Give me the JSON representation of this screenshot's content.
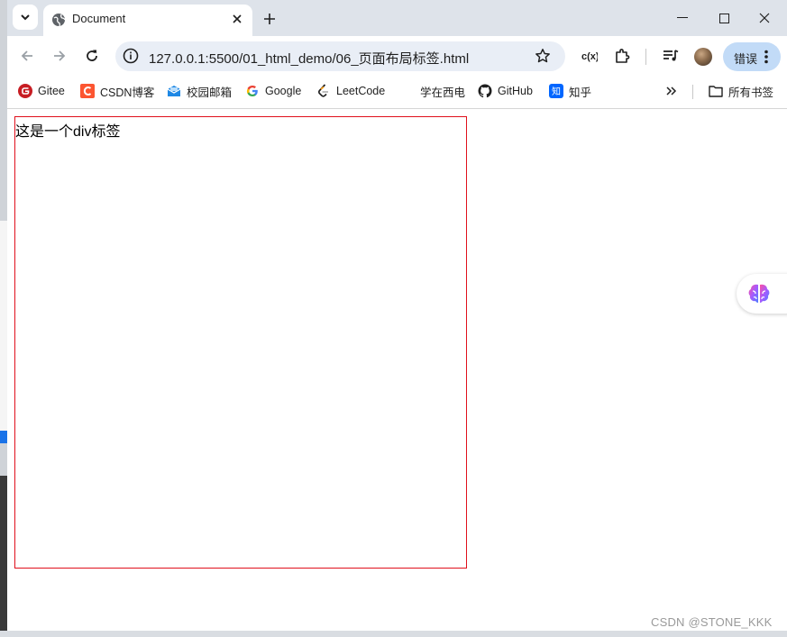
{
  "tab": {
    "title": "Document"
  },
  "omnibox": {
    "url": "127.0.0.1:5500/01_html_demo/06_页面布局标签.html"
  },
  "toolbar": {
    "error_label": "错误"
  },
  "bookmarks": [
    {
      "label": "Gitee",
      "icon": "gitee-icon",
      "color": "#c71d23"
    },
    {
      "label": "CSDN博客",
      "icon": "csdn-icon",
      "color": "#fc5531"
    },
    {
      "label": "校园邮箱",
      "icon": "mail-icon",
      "color": "#1e88e5"
    },
    {
      "label": "Google",
      "icon": "google-icon",
      "color": "#4285f4"
    },
    {
      "label": "LeetCode",
      "icon": "leetcode-icon",
      "color": "#ffa116"
    },
    {
      "label": "学在西电",
      "icon": "",
      "color": ""
    },
    {
      "label": "GitHub",
      "icon": "github-icon",
      "color": "#1f1f1f"
    },
    {
      "label": "知乎",
      "icon": "zhihu-icon",
      "color": "#0066ff"
    }
  ],
  "all_bookmarks_label": "所有书签",
  "page": {
    "div_text": "这是一个div标签",
    "div_border_color": "#e0101c"
  },
  "watermark": "CSDN @STONE_KKK"
}
